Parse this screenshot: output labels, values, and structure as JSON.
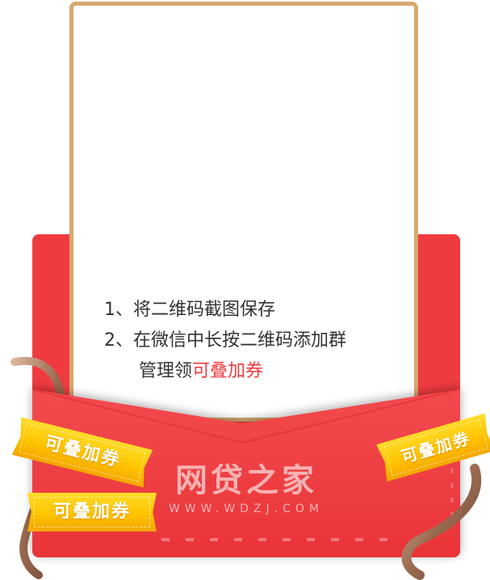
{
  "instructions": {
    "step1": "1、将二维码截图保存",
    "step2_main": "2、在微信中长按二维码添加群",
    "step2_cont_prefix": "管理领",
    "step2_cont_highlight": "可叠加券"
  },
  "tags": {
    "tag1": "可叠加券",
    "tag2": "可叠加券",
    "tag3": "可叠加券"
  },
  "watermark": {
    "logo": "网贷之家",
    "url": "WWW.WDZJ.COM"
  },
  "colors": {
    "envelope_red": "#ef3b3f",
    "card_border": "#d6a86e",
    "tag_gold": "#ffc400",
    "text_dark": "#333333"
  }
}
